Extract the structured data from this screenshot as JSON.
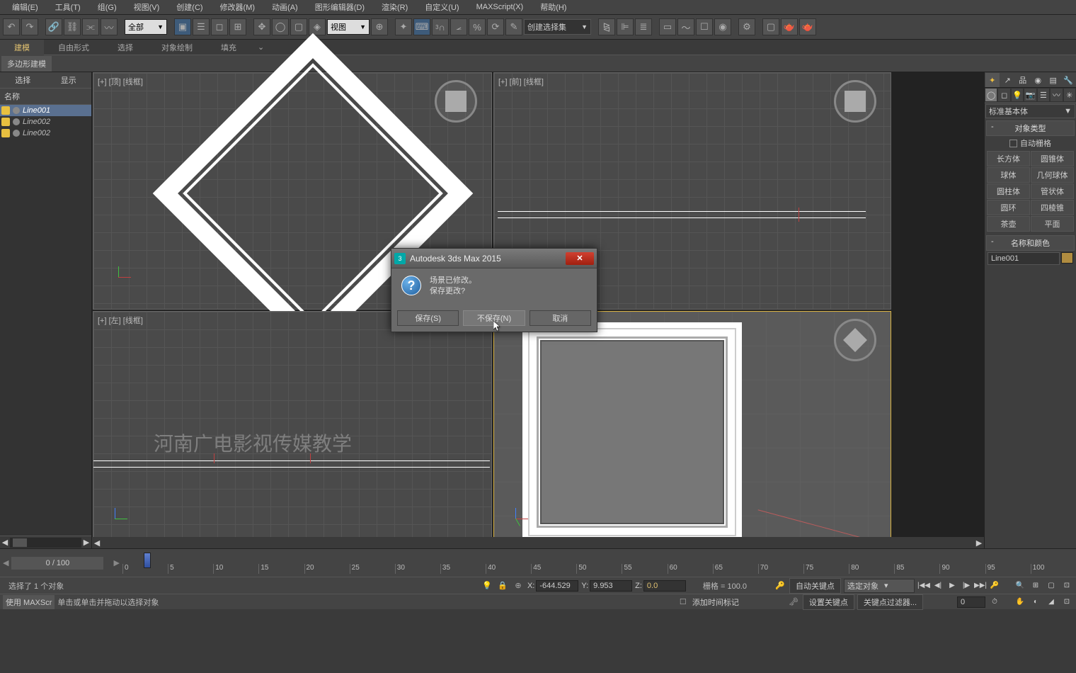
{
  "menubar": [
    {
      "label": "编辑(E)"
    },
    {
      "label": "工具(T)"
    },
    {
      "label": "组(G)"
    },
    {
      "label": "视图(V)"
    },
    {
      "label": "创建(C)"
    },
    {
      "label": "修改器(M)"
    },
    {
      "label": "动画(A)"
    },
    {
      "label": "图形编辑器(D)"
    },
    {
      "label": "渲染(R)"
    },
    {
      "label": "自定义(U)"
    },
    {
      "label": "MAXScript(X)"
    },
    {
      "label": "帮助(H)"
    }
  ],
  "toolbar": {
    "filter_dropdown": "全部",
    "ref_dropdown": "视图",
    "set_dropdown": "创建选择集"
  },
  "ribbon": {
    "tabs": [
      {
        "label": "建模",
        "active": true
      },
      {
        "label": "自由形式"
      },
      {
        "label": "选择"
      },
      {
        "label": "对象绘制"
      },
      {
        "label": "填充"
      }
    ],
    "sub_label": "多边形建模"
  },
  "scene_panel": {
    "select_tab": "选择",
    "display_tab": "显示",
    "name_header": "名称",
    "items": [
      {
        "name": "Line001",
        "selected": true
      },
      {
        "name": "Line002"
      },
      {
        "name": "Line002"
      }
    ]
  },
  "viewports": {
    "vp1": "[+] [顶] [线框]",
    "vp2": "[+] [前] [线框]",
    "vp3": "[+] [左] [线框]",
    "vp4": ""
  },
  "watermark": "河南广电影视传媒教学",
  "timeline": {
    "label": "0 / 100",
    "ticks": [
      "0",
      "5",
      "10",
      "15",
      "20",
      "25",
      "30",
      "35",
      "40",
      "45",
      "50",
      "55",
      "60",
      "65",
      "70",
      "75",
      "80",
      "85",
      "90",
      "95",
      "100"
    ]
  },
  "status": {
    "selection": "选择了 1 个对象",
    "x": "-644.529",
    "y": "9.953",
    "z": "0.0",
    "grid": "栅格 = 100.0",
    "auto_key": "自动关键点",
    "sel_dropdown": "选定对象",
    "set_key": "设置关键点",
    "key_filter": "关键点过滤器...",
    "add_time": "添加时间标记",
    "help": "单击或单击并拖动以选择对象",
    "script_tab": "使用 MAXScr"
  },
  "command_panel": {
    "dropdown": "标准基本体",
    "section1": "对象类型",
    "auto_grid": "自动栅格",
    "objects": [
      {
        "name": "长方体"
      },
      {
        "name": "圆锥体"
      },
      {
        "name": "球体"
      },
      {
        "name": "几何球体"
      },
      {
        "name": "圆柱体"
      },
      {
        "name": "管状体"
      },
      {
        "name": "圆环"
      },
      {
        "name": "四棱锥"
      },
      {
        "name": "茶壶"
      },
      {
        "name": "平面"
      }
    ],
    "section2": "名称和颜色",
    "name_field": "Line001"
  },
  "dialog": {
    "title": "Autodesk 3ds Max 2015",
    "line1": "场景已修改。",
    "line2": "保存更改?",
    "btn_save": "保存(S)",
    "btn_nosave": "不保存(N)",
    "btn_cancel": "取消"
  }
}
